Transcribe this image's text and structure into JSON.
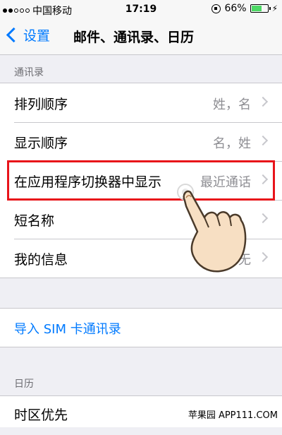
{
  "status_bar": {
    "carrier": "中国移动",
    "time": "17:19",
    "battery_percent": "66%",
    "battery_level": 0.66
  },
  "nav": {
    "back_label": "设置",
    "title": "邮件、通讯录、日历"
  },
  "contacts_section": {
    "header": "通讯录",
    "rows": [
      {
        "label": "排列顺序",
        "value": "姓，名"
      },
      {
        "label": "显示顺序",
        "value": "名，姓"
      },
      {
        "label": "在应用程序切换器中显示",
        "value": "最近通话"
      },
      {
        "label": "短名称",
        "value": ""
      },
      {
        "label": "我的信息",
        "value": "无"
      }
    ]
  },
  "import_sim": {
    "label": "导入 SIM 卡通讯录"
  },
  "calendar_section": {
    "header": "日历",
    "rows": [
      {
        "label": "时区优先"
      }
    ]
  },
  "watermark": "苹果园 APP111.COM",
  "colors": {
    "accent": "#007aff",
    "highlight_border": "#e8141a",
    "battery": "#4cd964"
  }
}
